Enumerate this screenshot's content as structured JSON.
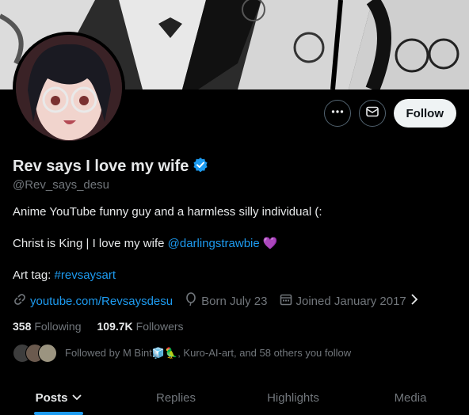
{
  "profile": {
    "display_name": "Rev says I love my wife",
    "handle": "@Rev_says_desu",
    "verified": true
  },
  "bio": {
    "line1": "Anime YouTube funny guy and a harmless silly individual (:",
    "line2_text": "Christ is King | I love my wife ",
    "line2_mention": "@darlingstrawbie",
    "line2_emoji": "💜",
    "line3_text": "Art tag: ",
    "line3_hashtag": "#revsaysart"
  },
  "meta": {
    "website": "youtube.com/Revsaysdesu",
    "born": "Born July 23",
    "joined": "Joined January 2017"
  },
  "stats": {
    "following_count": "358",
    "following_label": "Following",
    "followers_count": "109.7K",
    "followers_label": "Followers"
  },
  "followed_by": "Followed by M Bint🧊🦜, Kuro-AI-art, and 58 others you follow",
  "actions": {
    "follow_label": "Follow"
  },
  "tabs": [
    {
      "label": "Posts",
      "active": true
    },
    {
      "label": "Replies",
      "active": false
    },
    {
      "label": "Highlights",
      "active": false
    },
    {
      "label": "Media",
      "active": false
    }
  ],
  "colors": {
    "accent": "#1d9bf0",
    "background": "#000000",
    "text": "#e7e9ea",
    "muted": "#71767b",
    "verified": "#1d9bf0"
  }
}
